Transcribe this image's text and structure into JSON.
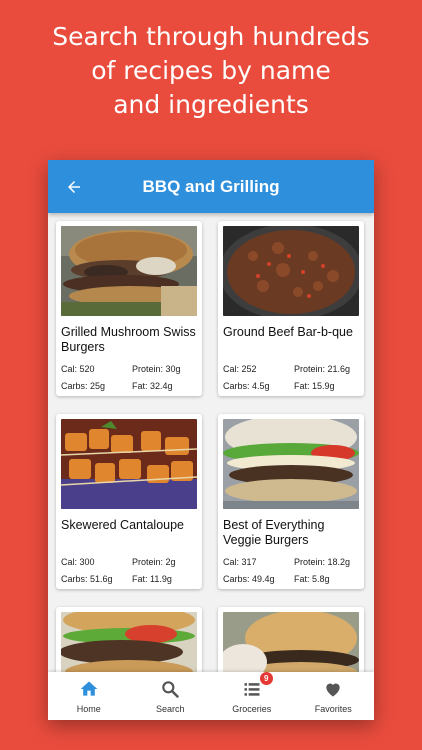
{
  "headline": {
    "line1": "Search through hundreds",
    "line2": "of recipes by name",
    "line3": "and ingredients"
  },
  "appbar": {
    "title": "BBQ and Grilling",
    "back_icon": "arrow-left-icon"
  },
  "recipes": [
    {
      "title": "Grilled Mushroom Swiss Burgers",
      "cal": "Cal: 520",
      "protein": "Protein: 30g",
      "carbs": "Carbs: 25g",
      "fat": "Fat: 32.4g",
      "image": "mushroom-swiss-burger-photo"
    },
    {
      "title": "Ground Beef Bar-b-que",
      "cal": "Cal: 252",
      "protein": "Protein: 21.6g",
      "carbs": "Carbs: 4.5g",
      "fat": "Fat: 15.9g",
      "image": "ground-beef-bbq-photo"
    },
    {
      "title": "Skewered Cantaloupe",
      "cal": "Cal: 300",
      "protein": "Protein: 2g",
      "carbs": "Carbs: 51.6g",
      "fat": "Fat: 11.9g",
      "image": "cantaloupe-skewers-photo"
    },
    {
      "title": "Best of Everything Veggie Burgers",
      "cal": "Cal: 317",
      "protein": "Protein: 18.2g",
      "carbs": "Carbs: 49.4g",
      "fat": "Fat: 5.8g",
      "image": "veggie-burger-photo"
    },
    {
      "title": "",
      "image": "burger-photo-partial"
    },
    {
      "title": "",
      "image": "burger-photo-partial"
    }
  ],
  "bottom_nav": {
    "home": {
      "label": "Home",
      "icon": "home-icon",
      "color": "#2e8fdc"
    },
    "search": {
      "label": "Search",
      "icon": "search-icon"
    },
    "groceries": {
      "label": "Groceries",
      "icon": "list-icon",
      "badge": "9"
    },
    "favorites": {
      "label": "Favorites",
      "icon": "heart-icon"
    }
  },
  "colors": {
    "background": "#e94c3d",
    "appbar": "#2e8fdc",
    "badge": "#e53935"
  }
}
